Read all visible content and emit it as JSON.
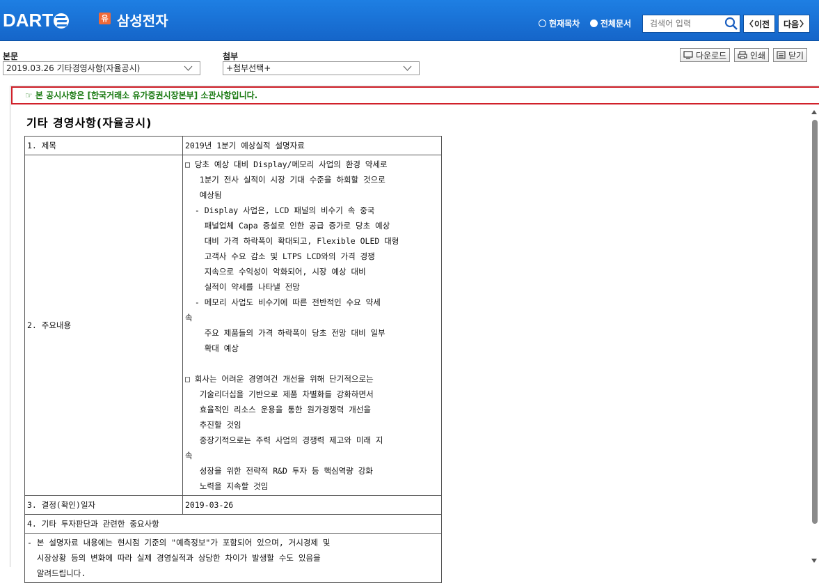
{
  "header": {
    "logo": "DART",
    "corp_badge": "유",
    "corp_name": "삼성전자",
    "radio_current": "현재목차",
    "radio_all": "전체문서",
    "search_placeholder": "검색어 입력",
    "prev_label": "이전",
    "next_label": "다음"
  },
  "toolbar": {
    "main_label": "본문",
    "main_select": "2019.03.26  기타경영사항(자율공시)",
    "attach_label": "첨부",
    "attach_select": "+첨부선택+",
    "download": "다운로드",
    "print": "인쇄",
    "close": "닫기"
  },
  "notice": "☞ 본 공시사항은 [한국거래소 유가증권시장본부] 소관사항입니다.",
  "doc": {
    "title": "기타 경영사항(자율공시)",
    "rows": {
      "r1_key": "1. 제목",
      "r1_val": "2019년 1분기 예상실적 설명자료",
      "r2_key": "2. 주요내용",
      "r2_val": "□ 당초 예상 대비 Display/메모리 사업의 환경 약세로\n   1분기 전사 실적이 시장 기대 수준을 하회할 것으로\n   예상됨\n  - Display 사업은, LCD 패널의 비수기 속 중국\n    패널업체 Capa 증설로 인한 공급 증가로 당초 예상\n    대비 가격 하락폭이 확대되고, Flexible OLED 대형\n    고객사 수요 감소 및 LTPS LCD와의 가격 경쟁\n    지속으로 수익성이 악화되어, 시장 예상 대비\n    실적이 약세를 나타낼 전망\n  - 메모리 사업도 비수기에 따른 전반적인 수요 약세\n속\n    주요 제품들의 가격 하락폭이 당초 전망 대비 일부\n    확대 예상\n\n□ 회사는 어려운 경영여건 개선을 위해 단기적으로는\n   기술리더십을 기반으로 제품 차별화를 강화하면서\n   효율적인 리소스 운용을 통한 원가경쟁력 개선을\n   추진할 것임\n   중장기적으로는 주력 사업의 경쟁력 제고와 미래 지\n속\n   성장을 위한 전략적 R&D 투자 등 핵심역량 강화\n   노력을 지속할 것임",
      "r3_key": "3. 결정(확인)일자",
      "r3_val": "2019-03-26",
      "r4_key": "4. 기타 투자판단과 관련한 중요사항",
      "r4_val": "- 본 설명자료 내용에는 현시점 기준의 \"예측정보\"가 포함되어 있으며, 거시경제 및\n  시장상황 등의 변화에 따라 실제 경영실적과 상당한 차이가 발생할 수도 있음을\n  알려드립니다."
    }
  }
}
